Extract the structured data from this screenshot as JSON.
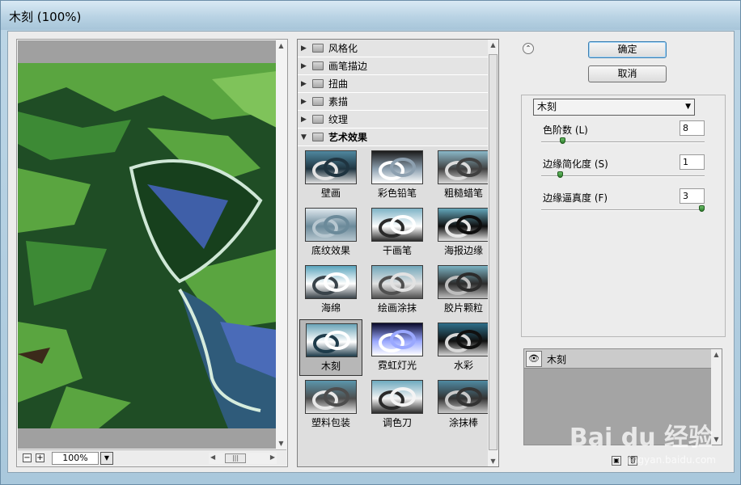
{
  "window": {
    "title": "木刻 (100%)"
  },
  "preview": {
    "zoom": "100%",
    "zoom_out": "−",
    "zoom_in": "+"
  },
  "categories": [
    {
      "label": "风格化",
      "open": false
    },
    {
      "label": "画笔描边",
      "open": false
    },
    {
      "label": "扭曲",
      "open": false
    },
    {
      "label": "素描",
      "open": false
    },
    {
      "label": "纹理",
      "open": false
    },
    {
      "label": "艺术效果",
      "open": true
    }
  ],
  "filters": [
    {
      "label": "壁画"
    },
    {
      "label": "彩色铅笔"
    },
    {
      "label": "粗糙蜡笔"
    },
    {
      "label": "底纹效果"
    },
    {
      "label": "干画笔"
    },
    {
      "label": "海报边缘"
    },
    {
      "label": "海绵"
    },
    {
      "label": "绘画涂抹"
    },
    {
      "label": "胶片颗粒"
    },
    {
      "label": "木刻",
      "selected": true
    },
    {
      "label": "霓虹灯光"
    },
    {
      "label": "水彩"
    },
    {
      "label": "塑料包装"
    },
    {
      "label": "调色刀"
    },
    {
      "label": "涂抹棒"
    }
  ],
  "buttons": {
    "ok": "确定",
    "cancel": "取消"
  },
  "settings": {
    "filter_name": "木刻",
    "params": [
      {
        "label": "色阶数 (L)",
        "value": "8",
        "fraction": 0.12
      },
      {
        "label": "边缘简化度 (S)",
        "value": "1",
        "fraction": 0.1
      },
      {
        "label": "边缘逼真度 (F)",
        "value": "3",
        "fraction": 1.0
      }
    ]
  },
  "layers": [
    {
      "name": "木刻",
      "visible": true
    }
  ],
  "watermark": {
    "brand": "Bai du 经验",
    "url": "jingyan.baidu.com"
  }
}
